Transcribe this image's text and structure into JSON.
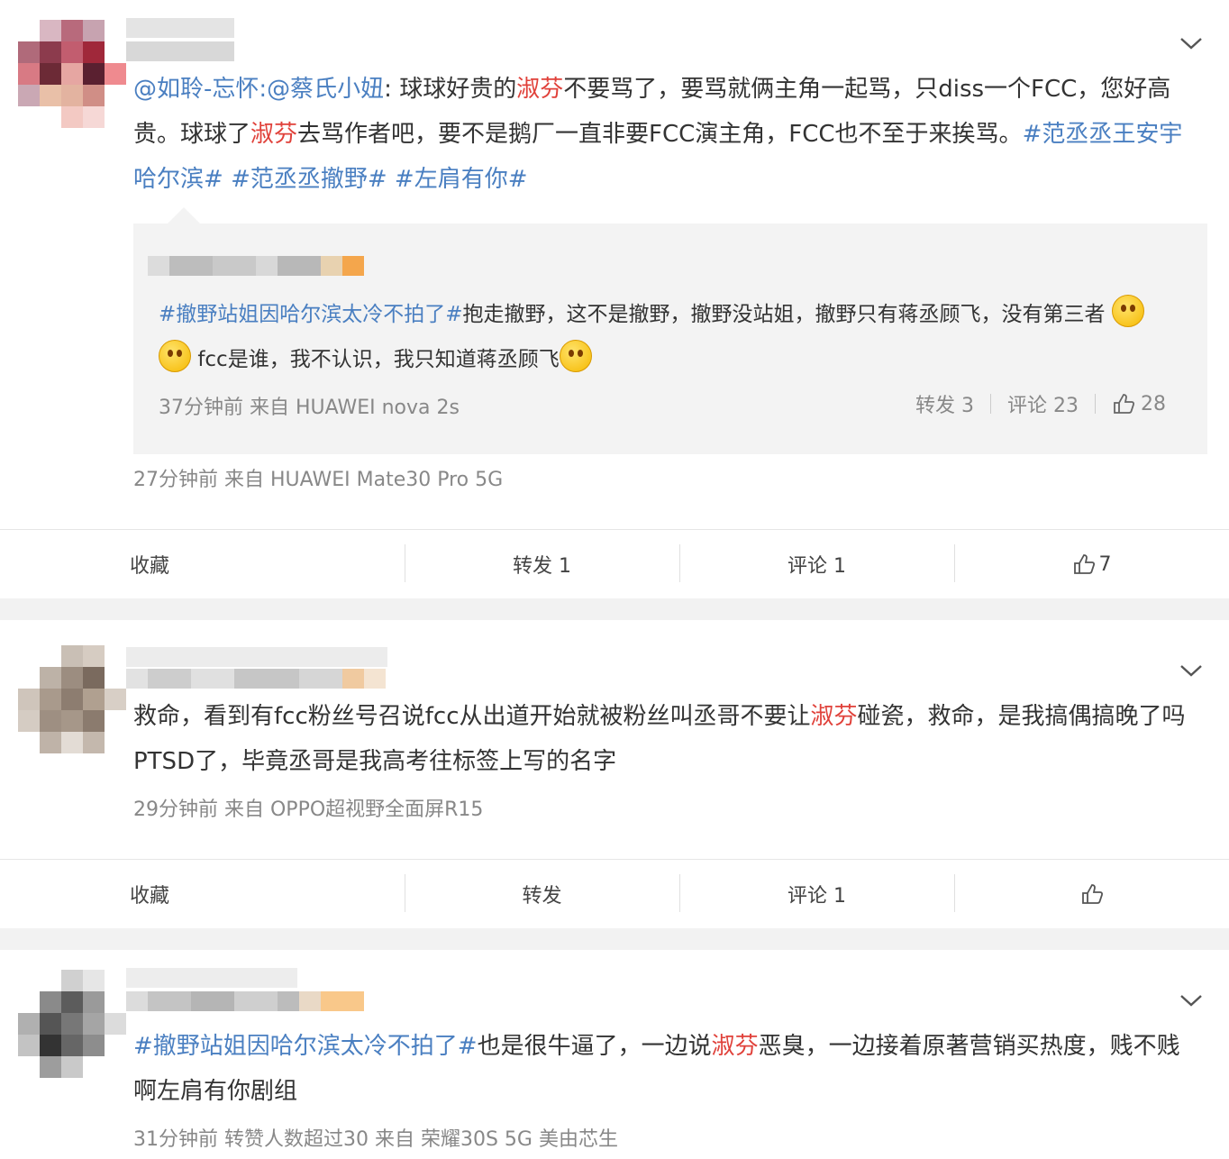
{
  "posts": [
    {
      "text_parts": [
        {
          "t": "@如聆-忘怀:",
          "cls": "link"
        },
        {
          "t": "@蔡氏小妞",
          "cls": "link"
        },
        {
          "t": ": 球球好贵的",
          "cls": ""
        },
        {
          "t": "淑芬",
          "cls": "red"
        },
        {
          "t": "不要骂了，要骂就俩主角一起骂，只diss一个FCC，您好高贵。球球了",
          "cls": ""
        },
        {
          "t": "淑芬",
          "cls": "red"
        },
        {
          "t": "去骂作者吧，要不是鹅厂一直非要FCC演主角，FCC也不至于来挨骂。",
          "cls": ""
        },
        {
          "t": "#范丞丞王安宇哈尔滨#",
          "cls": "link"
        },
        {
          "t": " ",
          "cls": ""
        },
        {
          "t": "#范丞丞撤野#",
          "cls": "link"
        },
        {
          "t": " ",
          "cls": ""
        },
        {
          "t": "#左肩有你#",
          "cls": "link"
        }
      ],
      "quote": {
        "text_a_link": "#撤野站姐因哈尔滨太冷不拍了#",
        "text_a": "抱走撤野，这不是撤野，撤野没站姐，撤野只有蒋丞顾飞，没有第三者",
        "text_b": "fcc是谁，我不认识，我只知道蒋丞顾飞",
        "meta": "37分钟前 来自 HUAWEI nova 2s",
        "repost": "转发 3",
        "comment": "评论 23",
        "likes": "28"
      },
      "meta": "27分钟前  来自 HUAWEI Mate30 Pro 5G",
      "actions": {
        "fav": "收藏",
        "repost": "转发 1",
        "comment": "评论 1",
        "likes": "7"
      }
    },
    {
      "text_parts": [
        {
          "t": "救命，看到有fcc粉丝号召说fcc从出道开始就被粉丝叫丞哥不要让",
          "cls": ""
        },
        {
          "t": "淑芬",
          "cls": "red"
        },
        {
          "t": "碰瓷，救命，是我搞偶搞晚了吗 PTSD了，毕竟丞哥是我高考往标签上写的名字",
          "cls": ""
        }
      ],
      "meta": "29分钟前  来自 OPPO超视野全面屏R15",
      "actions": {
        "fav": "收藏",
        "repost": "转发",
        "comment": "评论 1",
        "likes": ""
      }
    },
    {
      "text_parts": [
        {
          "t": "#撤野站姐因哈尔滨太冷不拍了#",
          "cls": "link"
        },
        {
          "t": "也是很牛逼了，一边说",
          "cls": ""
        },
        {
          "t": "淑芬",
          "cls": "red"
        },
        {
          "t": "恶臭，一边接着原著营销买热度，贱不贱啊左肩有你剧组",
          "cls": ""
        }
      ],
      "meta": "31分钟前 转赞人数超过30  来自 荣耀30S 5G 美由芯生"
    }
  ]
}
